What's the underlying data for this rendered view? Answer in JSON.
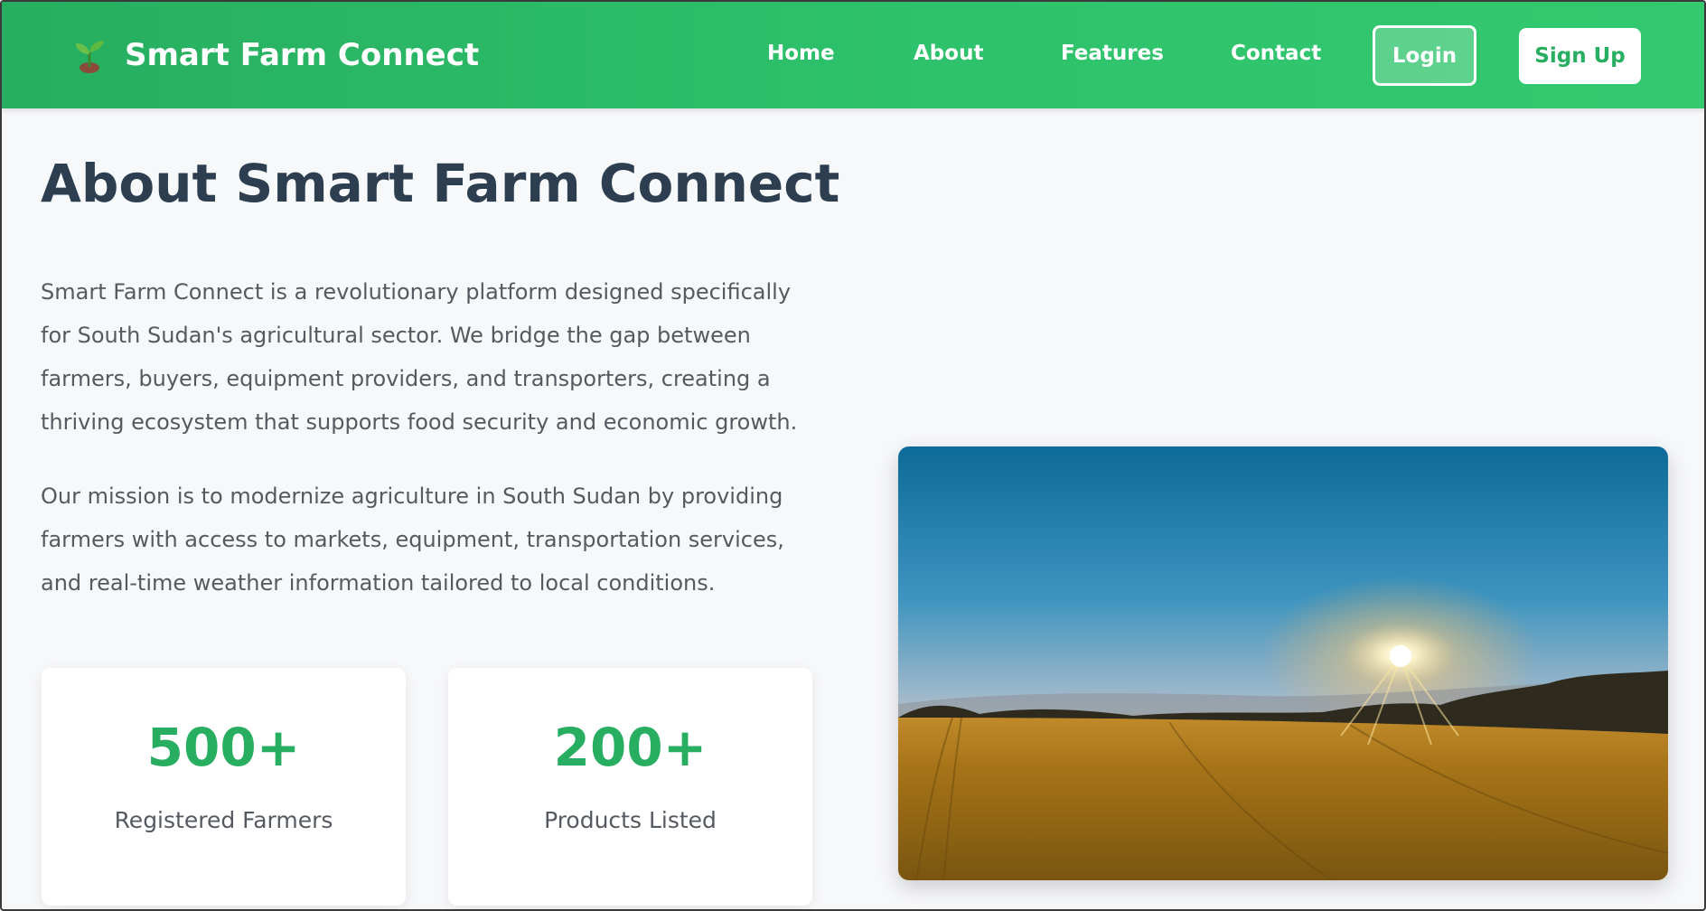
{
  "brand": {
    "name": "Smart Farm Connect",
    "icon": "seedling-icon"
  },
  "nav": {
    "links": [
      "Home",
      "About",
      "Features",
      "Contact"
    ],
    "login_label": "Login",
    "signup_label": "Sign Up"
  },
  "about": {
    "title": "About Smart Farm Connect",
    "paragraphs": [
      "Smart Farm Connect is a revolutionary platform designed specifically for South Sudan's agricultural sector. We bridge the gap between farmers, buyers, equipment providers, and transporters, creating a thriving ecosystem that supports food security and economic growth.",
      "Our mission is to modernize agriculture in South Sudan by providing farmers with access to markets, equipment, transportation services, and real-time weather information tailored to local conditions."
    ],
    "stats": [
      {
        "value": "500+",
        "label": "Registered Farmers"
      },
      {
        "value": "200+",
        "label": "Products Listed"
      }
    ],
    "image": "farm-field-sunset-image"
  },
  "colors": {
    "primary": "#27ae60",
    "heading": "#2c3e50",
    "text": "#555a60",
    "background": "#f7f8fa"
  }
}
